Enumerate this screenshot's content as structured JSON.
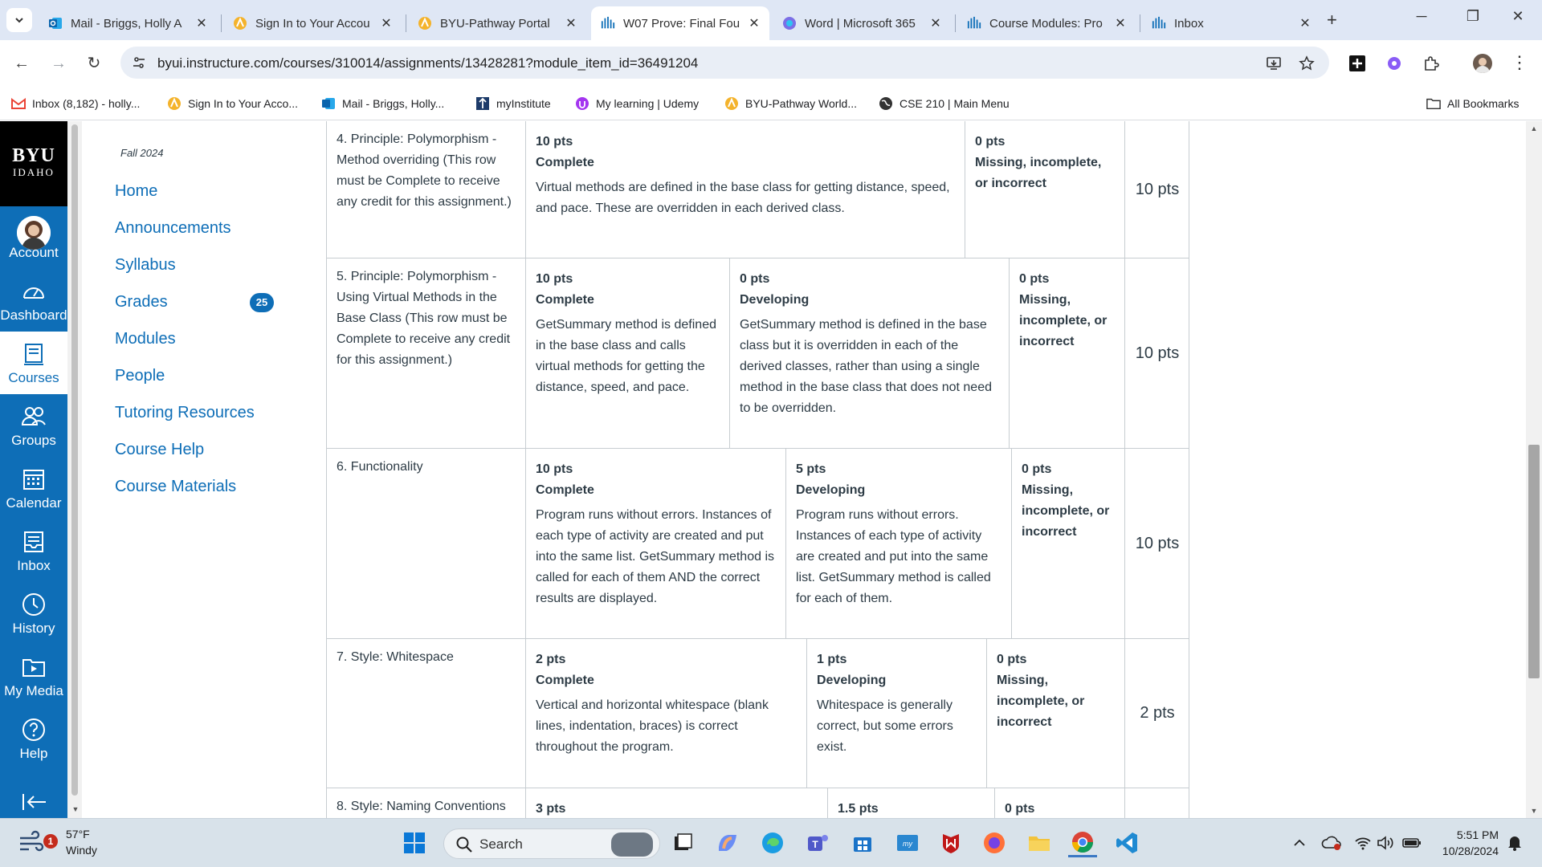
{
  "browser": {
    "tabs": [
      {
        "title": "Mail - Briggs, Holly A",
        "icon": "outlook-icon",
        "active": false
      },
      {
        "title": "Sign In to Your Accou",
        "icon": "pathway-icon",
        "active": false
      },
      {
        "title": "BYU-Pathway Portal",
        "icon": "pathway-icon",
        "active": false
      },
      {
        "title": "W07 Prove: Final Fou",
        "icon": "canvas-icon",
        "active": true
      },
      {
        "title": "Word | Microsoft 365",
        "icon": "copilot-icon",
        "active": false
      },
      {
        "title": "Course Modules: Pro",
        "icon": "canvas-icon",
        "active": false
      },
      {
        "title": "Inbox",
        "icon": "canvas-icon",
        "active": false
      }
    ],
    "url": "byui.instructure.com/courses/310014/assignments/13428281?module_item_id=36491204",
    "bookmarks": [
      {
        "label": "Inbox (8,182) - holly...",
        "icon": "gmail-icon"
      },
      {
        "label": "Sign In to Your Acco...",
        "icon": "pathway-icon"
      },
      {
        "label": "Mail - Briggs, Holly...",
        "icon": "outlook-icon"
      },
      {
        "label": "myInstitute",
        "icon": "myinstitute-icon"
      },
      {
        "label": "My learning | Udemy",
        "icon": "udemy-icon"
      },
      {
        "label": "BYU-Pathway World...",
        "icon": "pathway-icon"
      },
      {
        "label": "CSE 210 | Main Menu",
        "icon": "globe-icon"
      }
    ],
    "all_bookmarks": "All Bookmarks"
  },
  "global_nav": {
    "brand_line1": "BYU",
    "brand_line2": "IDAHO",
    "items": [
      {
        "label": "Account",
        "icon": "avatar-icon"
      },
      {
        "label": "Dashboard",
        "icon": "dashboard-icon"
      },
      {
        "label": "Courses",
        "icon": "courses-icon"
      },
      {
        "label": "Groups",
        "icon": "groups-icon"
      },
      {
        "label": "Calendar",
        "icon": "calendar-icon"
      },
      {
        "label": "Inbox",
        "icon": "inbox-icon"
      },
      {
        "label": "History",
        "icon": "history-icon"
      },
      {
        "label": "My Media",
        "icon": "my-media-icon"
      },
      {
        "label": "Help",
        "icon": "help-icon"
      }
    ],
    "active": "Courses"
  },
  "course_nav": {
    "term": "Fall 2024",
    "items": [
      "Home",
      "Announcements",
      "Syllabus",
      "Grades",
      "Modules",
      "People",
      "Tutoring Resources",
      "Course Help",
      "Course Materials"
    ],
    "grades_badge": "25"
  },
  "rubric": {
    "rows": [
      {
        "criterion": "4. Principle: Polymorphism - Method overriding (This row must be Complete to receive any credit for this assignment.)",
        "ratings": [
          {
            "pts": "10 pts",
            "name": "Complete",
            "desc": "Virtual methods are defined in the base class for getting distance, speed, and pace. These are overridden in each derived class."
          },
          {
            "pts": "0 pts",
            "name": "Missing, incomplete, or incorrect",
            "desc": ""
          }
        ],
        "total": "10 pts"
      },
      {
        "criterion": "5. Principle: Polymorphism - Using Virtual Methods in the Base Class (This row must be Complete to receive any credit for this assignment.)",
        "ratings": [
          {
            "pts": "10 pts",
            "name": "Complete",
            "desc": "GetSummary method is defined in the base class and calls virtual methods for getting the distance, speed, and pace."
          },
          {
            "pts": "0 pts",
            "name": "Developing",
            "desc": "GetSummary method is defined in the base class but it is overridden in each of the derived classes, rather than using a single method in the base class that does not need to be overridden."
          },
          {
            "pts": "0 pts",
            "name": "Missing, incomplete, or incorrect",
            "desc": ""
          }
        ],
        "total": "10 pts"
      },
      {
        "criterion": "6. Functionality",
        "ratings": [
          {
            "pts": "10 pts",
            "name": "Complete",
            "desc": "Program runs without errors. Instances of each type of activity are created and put into the same list. GetSummary method is called for each of them AND the correct results are displayed."
          },
          {
            "pts": "5 pts",
            "name": "Developing",
            "desc": "Program runs without errors. Instances of each type of activity are created and put into the same list. GetSummary method is called for each of them."
          },
          {
            "pts": "0 pts",
            "name": "Missing, incomplete, or incorrect",
            "desc": ""
          }
        ],
        "total": "10 pts"
      },
      {
        "criterion": "7. Style: Whitespace",
        "ratings": [
          {
            "pts": "2 pts",
            "name": "Complete",
            "desc": "Vertical and horizontal whitespace (blank lines, indentation, braces) is correct throughout the program."
          },
          {
            "pts": "1 pts",
            "name": "Developing",
            "desc": "Whitespace is generally correct, but some errors exist."
          },
          {
            "pts": "0 pts",
            "name": "Missing, incomplete, or incorrect",
            "desc": ""
          }
        ],
        "total": "2 pts"
      },
      {
        "criterion": "8. Style: Naming Conventions",
        "ratings": [
          {
            "pts": "3 pts",
            "name": "",
            "desc": ""
          },
          {
            "pts": "1.5 pts",
            "name": "",
            "desc": ""
          },
          {
            "pts": "0 pts",
            "name": "",
            "desc": ""
          }
        ],
        "total": ""
      }
    ]
  },
  "taskbar": {
    "weather_temp": "57°F",
    "weather_cond": "Windy",
    "weather_badge": "1",
    "search_label": "Search",
    "time": "5:51 PM",
    "date": "10/28/2024"
  },
  "colors": {
    "canvas_blue": "#0e6eb7",
    "tab_strip": "#dfe7f5",
    "taskbar": "#d8e2ea"
  }
}
